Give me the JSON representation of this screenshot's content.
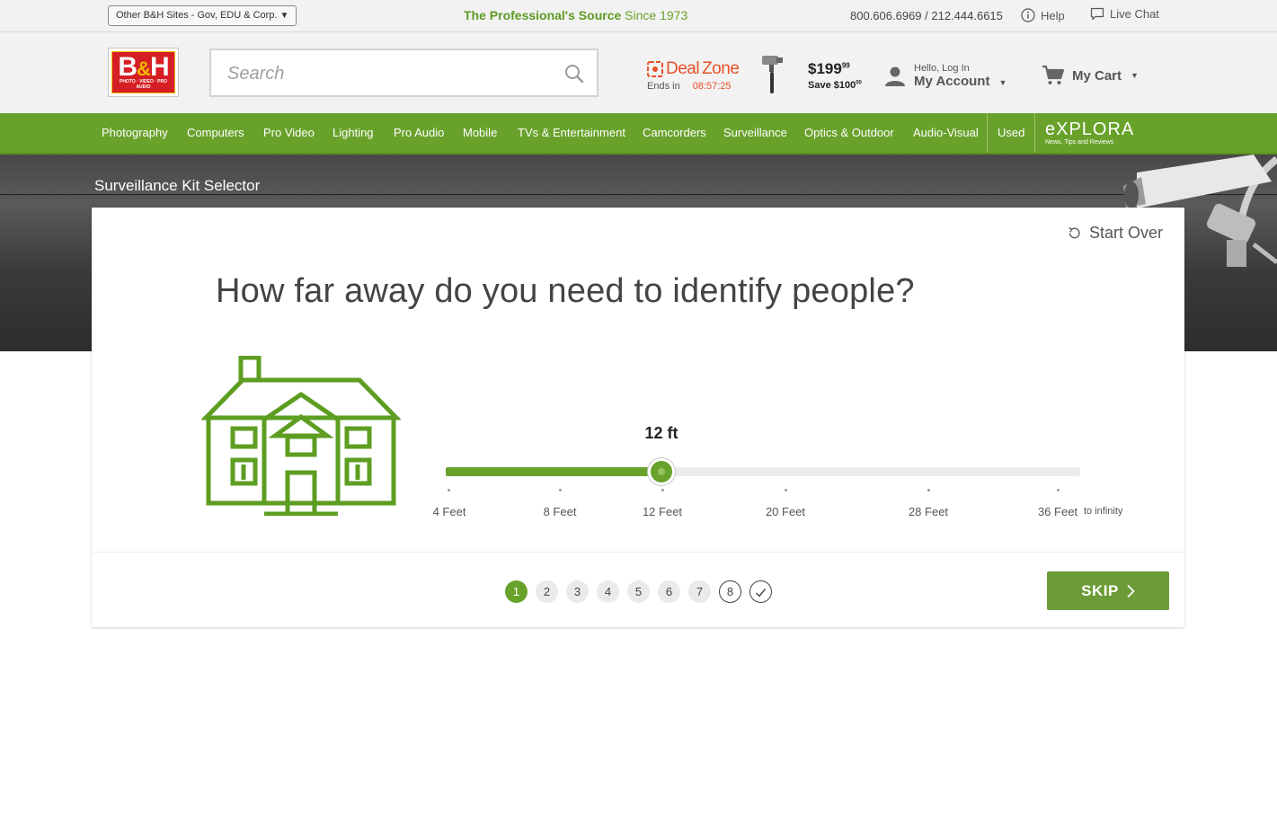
{
  "topbar": {
    "other_sites": "Other B&H Sites - Gov, EDU & Corp.",
    "tagline_bold": "The Professional's Source",
    "tagline_rest": " Since 1973",
    "phones": "800.606.6969 / 212.444.6615",
    "help": "Help",
    "live_chat": "Live Chat"
  },
  "header": {
    "logo_text": "B",
    "logo_amp": "&",
    "logo_text2": "H",
    "logo_sub": "PHOTO · VIDEO · PRO AUDIO",
    "search_placeholder": "Search",
    "deal_zone": {
      "label_deal": "Deal",
      "label_zone": "Zone",
      "ends_in": "Ends in",
      "timer": "08:57:25",
      "price": "$199",
      "price_cents": "99",
      "save": "Save $100",
      "save_cents": "00"
    },
    "account": {
      "hello": "Hello, Log In",
      "label": "My Account"
    },
    "cart": {
      "label": "My Cart"
    }
  },
  "nav": {
    "items": [
      "Photography",
      "Computers",
      "Pro Video",
      "Lighting",
      "Pro Audio",
      "Mobile",
      "TVs & Entertainment",
      "Camcorders",
      "Surveillance",
      "Optics & Outdoor",
      "Audio-Visual",
      "Used"
    ],
    "explora": {
      "title": "eXPLORA",
      "subtitle": "News, Tips and Reviews"
    }
  },
  "hero": {
    "title": "Surveillance Kit Selector"
  },
  "selector": {
    "start_over": "Start Over",
    "question": "How far away do you need to identify people?",
    "current_value": "12 ft",
    "slider_min": 4,
    "slider_max": 36,
    "slider_value": 12,
    "ticks": [
      {
        "label": "4 Feet",
        "value": 4
      },
      {
        "label": "8 Feet",
        "value": 8
      },
      {
        "label": "12 Feet",
        "value": 12
      },
      {
        "label": "20 Feet",
        "value": 20
      },
      {
        "label": "28 Feet",
        "value": 28
      },
      {
        "label": "36 Feet",
        "value": 36
      }
    ],
    "infinity_label": "to infinity",
    "steps": [
      "1",
      "2",
      "3",
      "4",
      "5",
      "6",
      "7",
      "8"
    ],
    "active_step": "1",
    "skip_label": "SKIP"
  },
  "colors": {
    "brand_green": "#69a22b",
    "deal_orange": "#e8502a",
    "logo_red": "#d51f24"
  }
}
